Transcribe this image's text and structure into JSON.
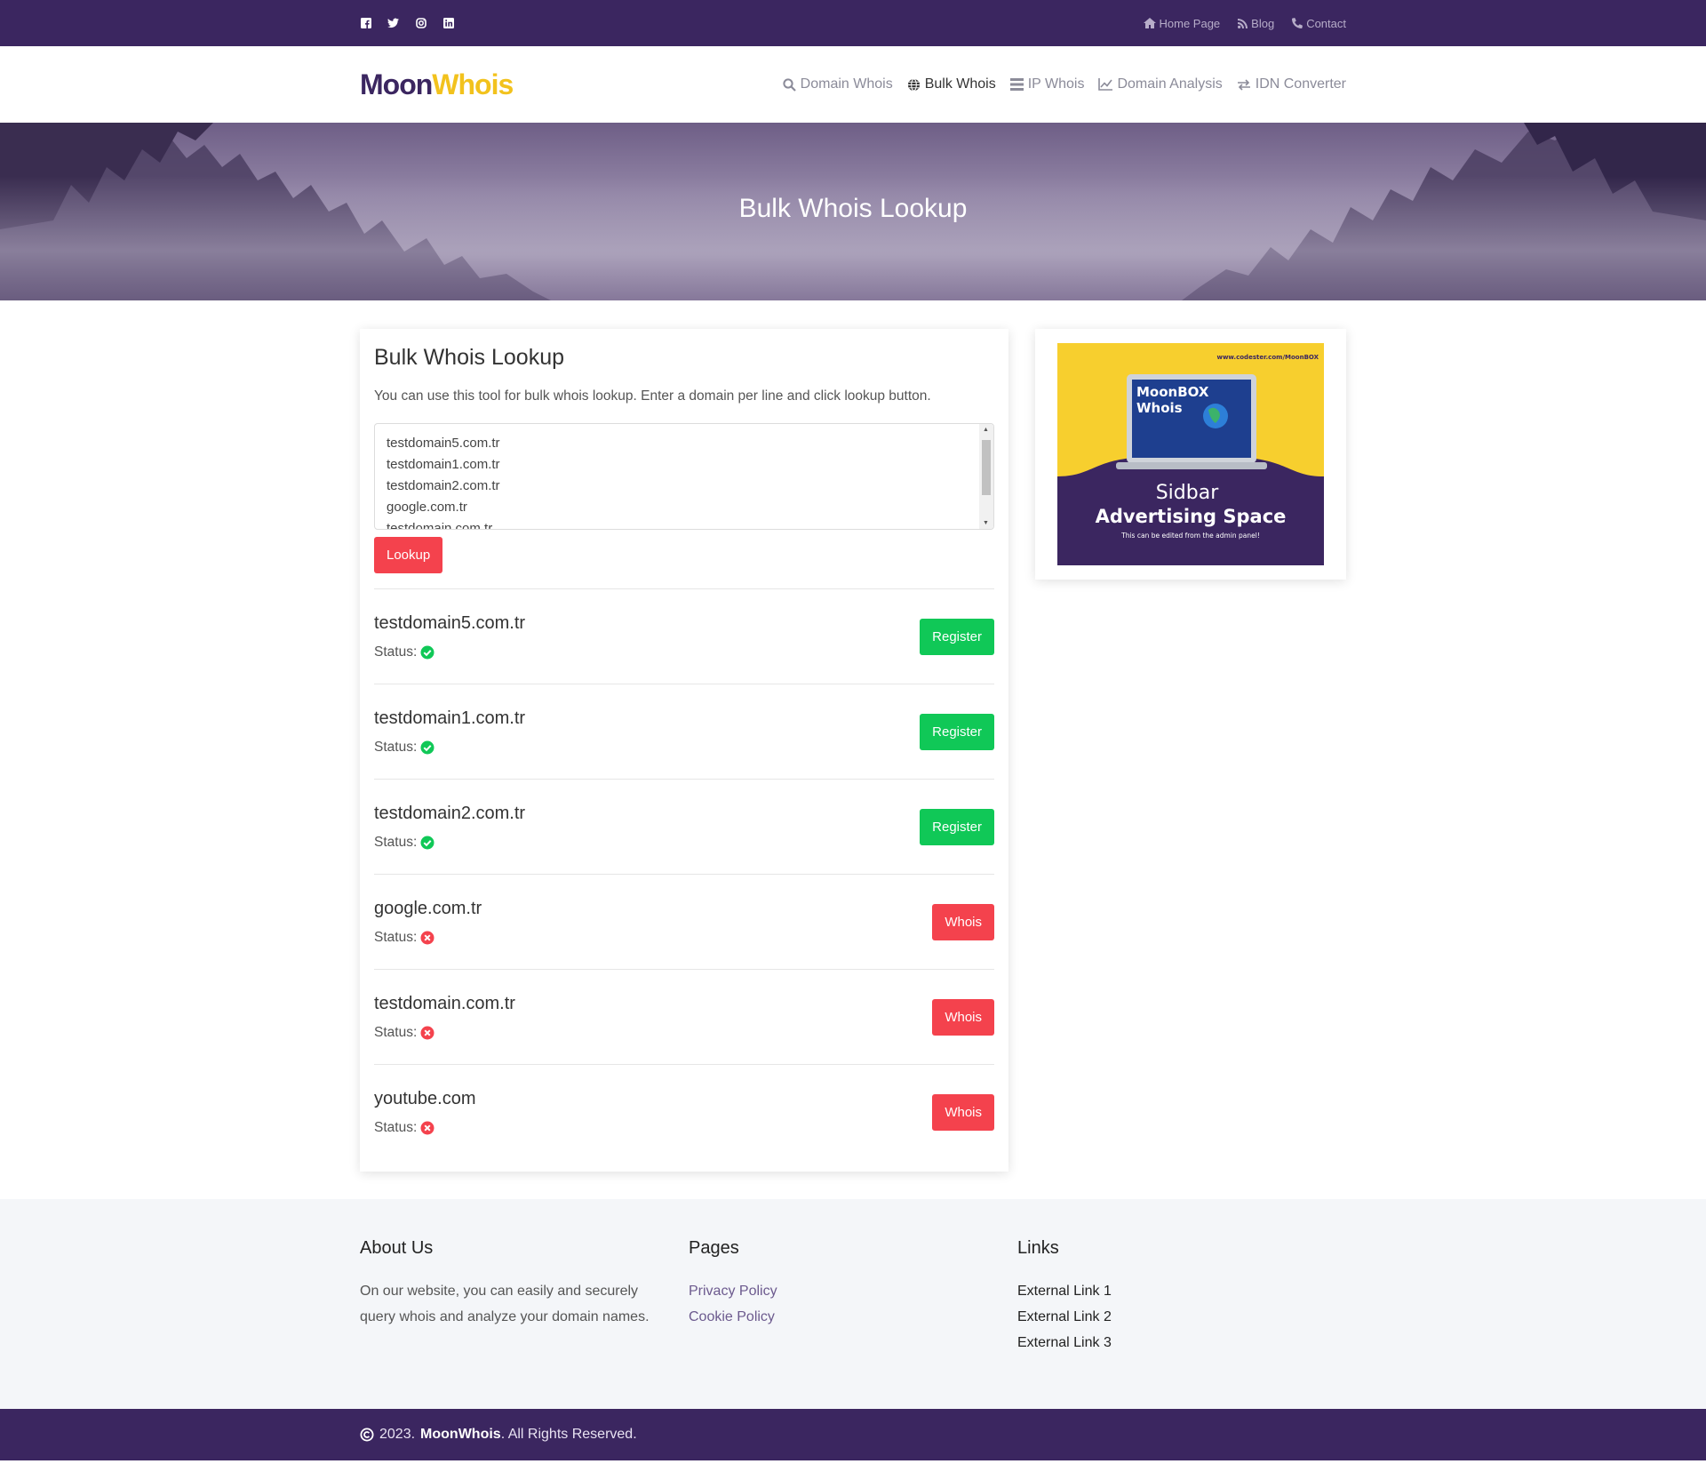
{
  "topbar": {
    "social": [
      "facebook-icon",
      "twitter-icon",
      "instagram-icon",
      "linkedin-icon"
    ],
    "links": [
      {
        "label": "Home Page",
        "icon": "home-icon"
      },
      {
        "label": "Blog",
        "icon": "rss-icon"
      },
      {
        "label": "Contact",
        "icon": "phone-icon"
      }
    ]
  },
  "brand": {
    "part1": "Moon",
    "part2": "Whois"
  },
  "nav": {
    "items": [
      {
        "label": "Domain Whois",
        "icon": "search-icon"
      },
      {
        "label": "Bulk Whois",
        "icon": "globe-icon"
      },
      {
        "label": "IP Whois",
        "icon": "server-icon"
      },
      {
        "label": "Domain Analysis",
        "icon": "line-chart-icon"
      },
      {
        "label": "IDN Converter",
        "icon": "exchange-icon"
      }
    ],
    "active": "Bulk Whois"
  },
  "hero": {
    "title": "Bulk Whois Lookup"
  },
  "tool": {
    "title": "Bulk Whois Lookup",
    "description": "You can use this tool for bulk whois lookup. Enter a domain per line and click lookup button.",
    "textarea_lines": [
      "testdomain5.com.tr",
      "testdomain1.com.tr",
      "testdomain2.com.tr",
      "google.com.tr",
      "testdomain.com.tr"
    ],
    "lookup_label": "Lookup",
    "status_label": "Status:"
  },
  "results": [
    {
      "domain": "testdomain5.com.tr",
      "available": true,
      "action": "Register"
    },
    {
      "domain": "testdomain1.com.tr",
      "available": true,
      "action": "Register"
    },
    {
      "domain": "testdomain2.com.tr",
      "available": true,
      "action": "Register"
    },
    {
      "domain": "google.com.tr",
      "available": false,
      "action": "Whois"
    },
    {
      "domain": "testdomain.com.tr",
      "available": false,
      "action": "Whois"
    },
    {
      "domain": "youtube.com",
      "available": false,
      "action": "Whois"
    }
  ],
  "ad": {
    "url": "www.codester.com/MoonBOX",
    "laptop_line1": "MoonBOX",
    "laptop_line2": "Whois",
    "line1": "Sidbar",
    "line2": "Advertising Space",
    "line3": "This can be edited from the admin panel!"
  },
  "footer": {
    "about_title": "About Us",
    "about_text": "On our website, you can easily and securely query whois and analyze your domain names.",
    "pages_title": "Pages",
    "pages": [
      "Privacy Policy",
      "Cookie Policy"
    ],
    "links_title": "Links",
    "links": [
      "External Link 1",
      "External Link 2",
      "External Link 3"
    ]
  },
  "copyright": {
    "year": "2023.",
    "brand": "MoonWhois",
    "suffix": ". All Rights Reserved."
  },
  "colors": {
    "brand_purple": "#3b2660",
    "brand_yellow": "#f2c21d",
    "green": "#10c857",
    "red": "#f4424d"
  }
}
